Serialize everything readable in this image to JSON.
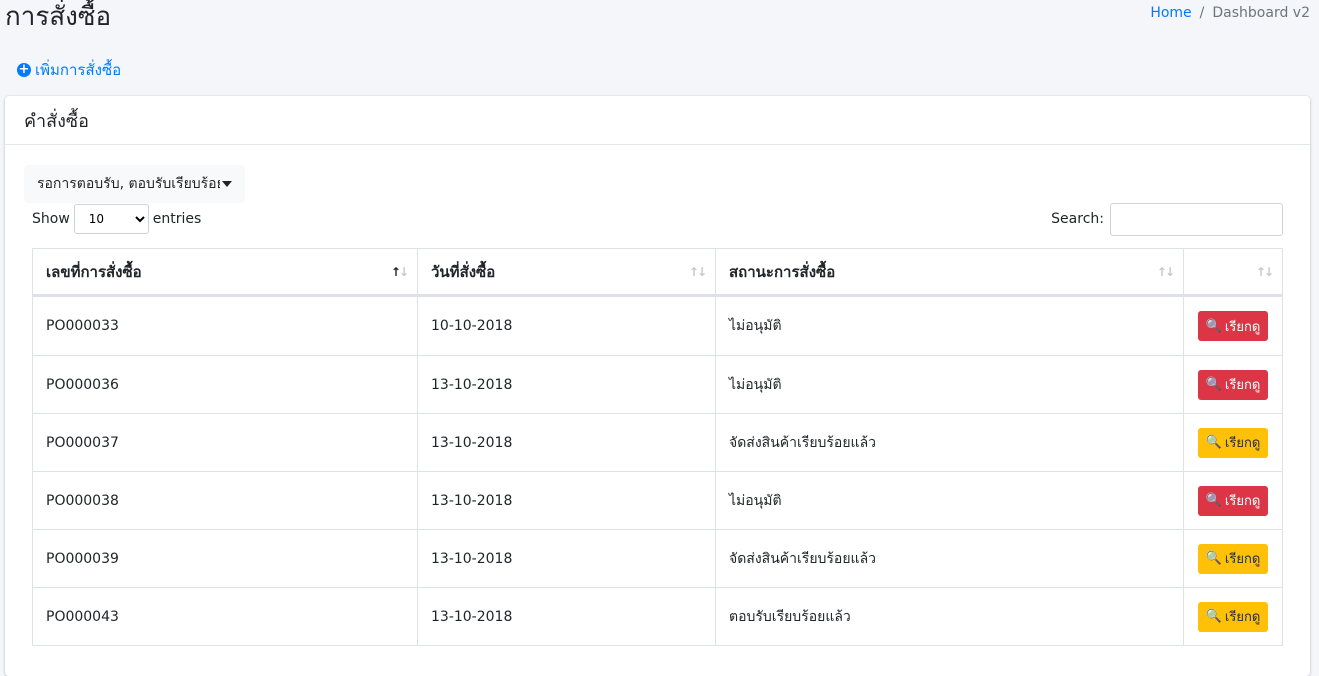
{
  "header": {
    "title": "การสั่งซื้อ",
    "breadcrumb": {
      "home": "Home",
      "separator": "/",
      "current": "Dashboard v2"
    },
    "add_link": "เพิ่มการสั่งซื้อ"
  },
  "card": {
    "title": "คำสั่งซื้อ",
    "filter_dropdown": "รอการตอบรับ, ตอบรับเรียบร้อยแล้ว"
  },
  "table_controls": {
    "show_label": "Show",
    "entries_value": "10",
    "entries_label": "entries",
    "search_label": "Search:",
    "search_value": ""
  },
  "table": {
    "columns": [
      "เลขที่การสั่งซื้อ",
      "วันที่สั่งซื้อ",
      "สถานะการสั่งซื้อ",
      ""
    ],
    "rows": [
      {
        "po": "PO000033",
        "date": "10-10-2018",
        "status": "ไม่อนุมัติ",
        "button": "เรียกดู",
        "button_color": "#dc3545"
      },
      {
        "po": "PO000036",
        "date": "13-10-2018",
        "status": "ไม่อนุมัติ",
        "button": "เรียกดู",
        "button_color": "#dc3545"
      },
      {
        "po": "PO000037",
        "date": "13-10-2018",
        "status": "จัดส่งสินค้าเรียบร้อยแล้ว",
        "button": "เรียกดู",
        "button_color": "#ffc107"
      },
      {
        "po": "PO000038",
        "date": "13-10-2018",
        "status": "ไม่อนุมัติ",
        "button": "เรียกดู",
        "button_color": "#dc3545"
      },
      {
        "po": "PO000039",
        "date": "13-10-2018",
        "status": "จัดส่งสินค้าเรียบร้อยแล้ว",
        "button": "เรียกดู",
        "button_color": "#ffc107"
      },
      {
        "po": "PO000043",
        "date": "13-10-2018",
        "status": "ตอบรับเรียบร้อยแล้ว",
        "button": "เรียกดู",
        "button_color": "#ffc107"
      }
    ]
  },
  "icons": {
    "add": "plus-circle-icon",
    "view": "search-icon",
    "sort": "sort-icon",
    "dropdown": "caret-down-icon"
  }
}
